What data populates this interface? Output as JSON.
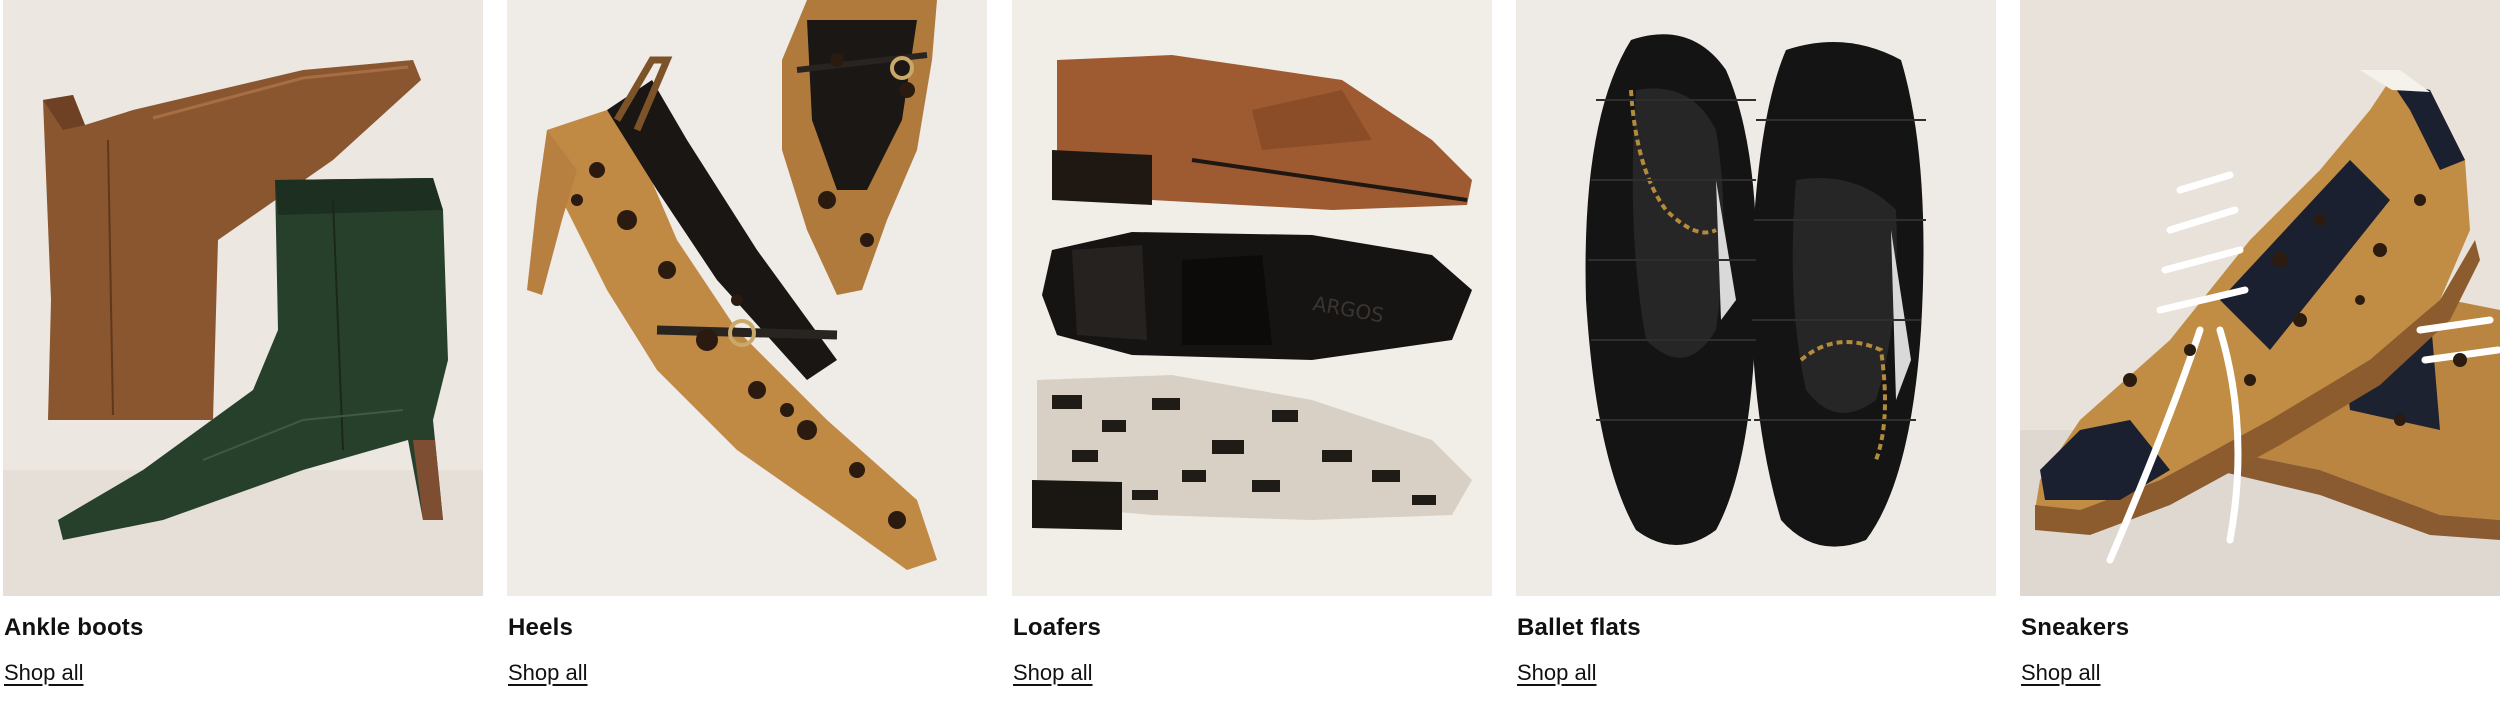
{
  "categories": [
    {
      "title": "Ankle boots",
      "link": "Shop all",
      "image_subject": "brown-suede-and-green-snakeskin-ankle-boots"
    },
    {
      "title": "Heels",
      "link": "Shop all",
      "image_subject": "leopard-print-heels"
    },
    {
      "title": "Loafers",
      "link": "Shop all",
      "image_subject": "brown-black-and-snakeskin-loafers",
      "image_brand_mark": "ARGOS"
    },
    {
      "title": "Ballet flats",
      "link": "Shop all",
      "image_subject": "black-woven-ballet-flats"
    },
    {
      "title": "Sneakers",
      "link": "Shop all",
      "image_subject": "leopard-print-sneakers"
    }
  ],
  "colors": {
    "text": "#111111",
    "photo_background": "#ece7e1"
  }
}
